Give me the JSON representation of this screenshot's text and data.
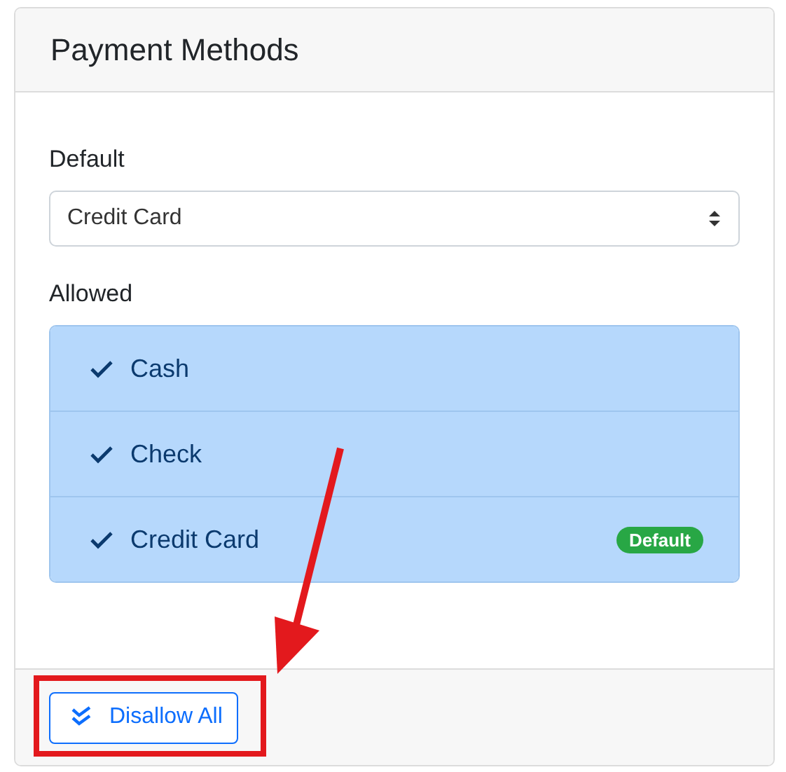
{
  "card": {
    "title": "Payment Methods"
  },
  "default_field": {
    "label": "Default",
    "value": "Credit Card"
  },
  "allowed": {
    "label": "Allowed",
    "items": [
      {
        "label": "Cash",
        "selected": true
      },
      {
        "label": "Check",
        "selected": true
      },
      {
        "label": "Credit Card",
        "selected": true,
        "badge": "Default"
      }
    ]
  },
  "footer_button": "Disallow All",
  "annotation": {
    "kind": "arrow-highlight"
  }
}
